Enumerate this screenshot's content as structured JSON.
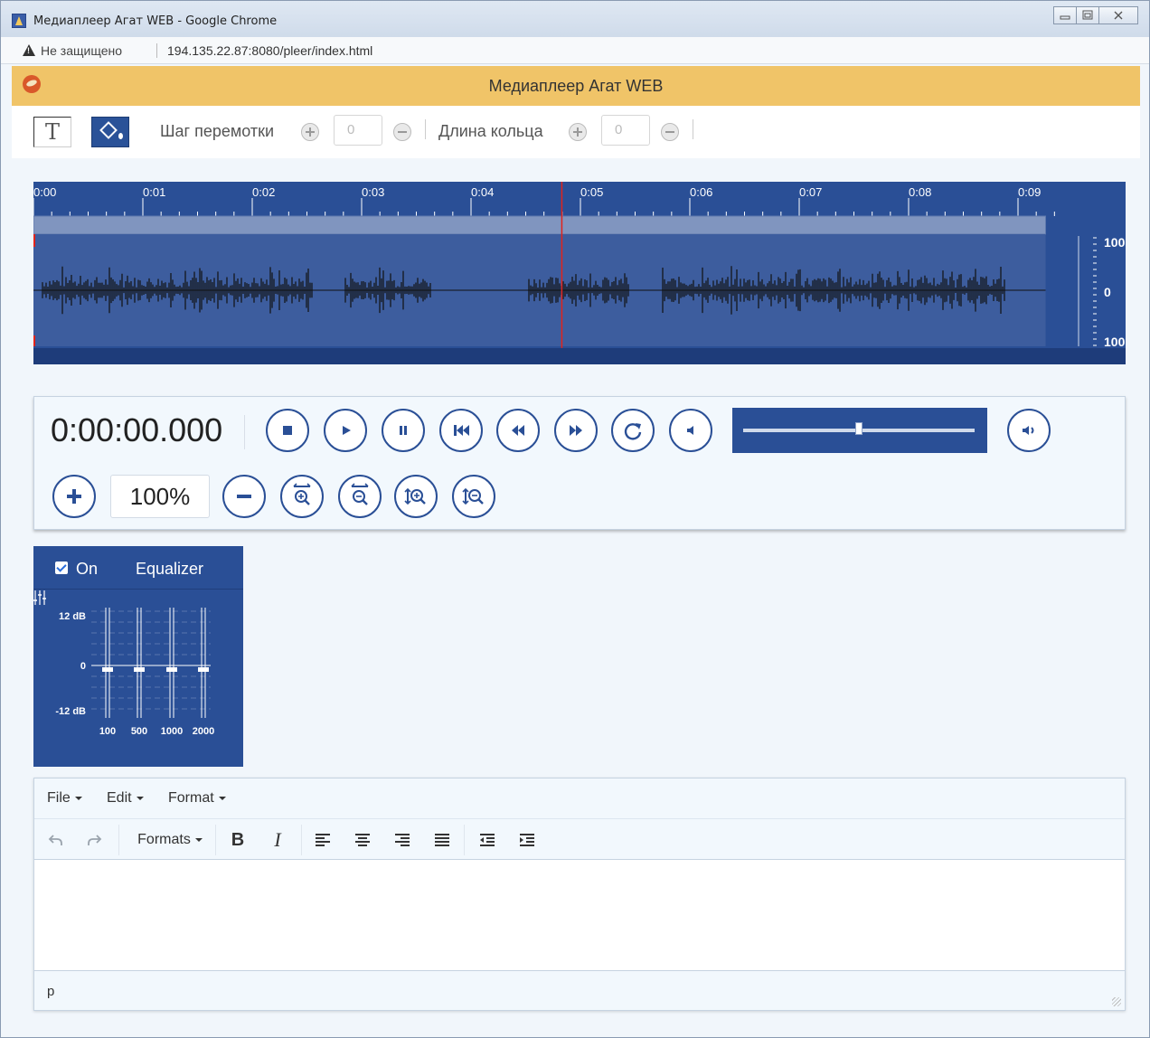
{
  "window": {
    "title": "Медиаплеер Агат WEB - Google Chrome",
    "buttons": [
      "minimize",
      "maximize",
      "close"
    ]
  },
  "address": {
    "security_label": "Не защищено",
    "url": "194.135.22.87:8080/pleer/index.html"
  },
  "app": {
    "title": "Медиаплеер Агат WEB"
  },
  "toolbar": {
    "text_tool_label": "T",
    "rewind_step_label": "Шаг перемотки",
    "rewind_step_placeholder": "0",
    "loop_length_label": "Длина кольца",
    "loop_length_placeholder": "0"
  },
  "waveform": {
    "time_ticks": [
      "0:00",
      "0:01",
      "0:02",
      "0:03",
      "0:04",
      "0:05",
      "0:06",
      "0:07",
      "0:08",
      "0:09"
    ],
    "scale_labels": [
      "100",
      "0",
      "100"
    ],
    "playhead_seconds": 4.83,
    "colors": {
      "background": "#2a4f96",
      "playhead": "#e2231a",
      "signal": "#111111"
    }
  },
  "transport": {
    "timecode": "0:00:00.000",
    "volume_level": 0.5,
    "zoom_value": "100%",
    "buttons": [
      "stop",
      "play",
      "pause",
      "skip-to-start",
      "rewind",
      "fast-forward",
      "loop",
      "mute",
      "volume"
    ],
    "zoom_buttons": [
      "zoom-in",
      "zoom-out",
      "zoom-in-horizontal",
      "zoom-out-horizontal",
      "zoom-in-vertical",
      "zoom-out-vertical"
    ]
  },
  "equalizer": {
    "enabled_label": "On",
    "title": "Equalizer",
    "scale": [
      "12 dB",
      "0",
      "-12 dB"
    ],
    "bands": [
      {
        "freq": "100",
        "gain_db": 0
      },
      {
        "freq": "500",
        "gain_db": 0
      },
      {
        "freq": "1000",
        "gain_db": 0
      },
      {
        "freq": "2000",
        "gain_db": 0
      }
    ]
  },
  "editor": {
    "menu": [
      "File",
      "Edit",
      "Format"
    ],
    "formats_label": "Formats",
    "bold_label": "B",
    "italic_label": "I",
    "status_path": "p"
  }
}
